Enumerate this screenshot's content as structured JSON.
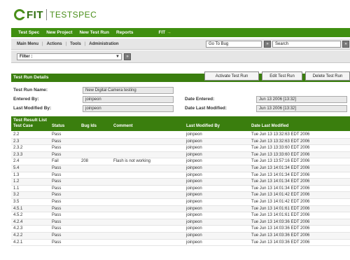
{
  "logo": {
    "fit": "FIT",
    "testspec": "TESTSPEC"
  },
  "main_nav": {
    "items": [
      "Test Spec",
      "New Project",
      "New Test Run",
      "Reports"
    ],
    "user": "FIT",
    "user_accent": "→"
  },
  "sub_nav": {
    "items": [
      "Main Menu",
      "Actions",
      "Tools",
      "Administration"
    ],
    "separator": "|",
    "goto_value": "Go To Bug",
    "search_value": "Search",
    "go_label": "»"
  },
  "filter": {
    "label": "Filter :",
    "chevron": "▼",
    "go_label": "»"
  },
  "test_run_details": {
    "title": "Test Run Details",
    "buttons": [
      "Activate Test Run",
      "Edit Test Run",
      "Delete Test Run"
    ],
    "fields": {
      "name_label": "Test Run Name:",
      "name_value": "New Digital Camera testing",
      "entered_by_label": "Entered By:",
      "entered_by_value": "joinpeon",
      "last_modified_by_label": "Last Modified By:",
      "last_modified_by_value": "joinpeon",
      "date_entered_label": "Date Entered:",
      "date_entered_value": "Jun 13 2006 [13:32]",
      "date_last_modified_label": "Date Last Modified:",
      "date_last_modified_value": "Jun 13 2006 [13:32]"
    }
  },
  "test_result_list": {
    "title": "Test Result List",
    "columns": [
      "Test Case",
      "Status",
      "Bug Ids",
      "Comment",
      "Last Modified By",
      "Date Last Modified"
    ],
    "rows": [
      {
        "case": "2.2",
        "status": "Pass",
        "bug": "",
        "comment": "",
        "mod": "joinpeon",
        "date": "Tue Jun 13 13:32:63 EDT 2006"
      },
      {
        "case": "2.3",
        "status": "Pass",
        "bug": "",
        "comment": "",
        "mod": "joinpeon",
        "date": "Tue Jun 13 13:32:63 EDT 2006"
      },
      {
        "case": "2.3.2",
        "status": "Pass",
        "bug": "",
        "comment": "",
        "mod": "joinpeon",
        "date": "Tue Jun 13 13:33:60 EDT 2006"
      },
      {
        "case": "2.3.3",
        "status": "Pass",
        "bug": "",
        "comment": "",
        "mod": "joinpeon",
        "date": "Tue Jun 13 13:33:60 EDT 2006"
      },
      {
        "case": "2.4",
        "status": "Fail",
        "bug": "208",
        "comment": "Flash is not working",
        "mod": "joinpeon",
        "date": "Tue Jun 13 13:57:16 EDT 2006"
      },
      {
        "case": "5.4",
        "status": "Pass",
        "bug": "",
        "comment": "",
        "mod": "joinpeon",
        "date": "Tue Jun 13 14:01:34 EDT 2006"
      },
      {
        "case": "1.3",
        "status": "Pass",
        "bug": "",
        "comment": "",
        "mod": "joinpeon",
        "date": "Tue Jun 13 14:01:34 EDT 2006"
      },
      {
        "case": "1.2",
        "status": "Pass",
        "bug": "",
        "comment": "",
        "mod": "joinpeon",
        "date": "Tue Jun 13 14:01:34 EDT 2006"
      },
      {
        "case": "1.1",
        "status": "Pass",
        "bug": "",
        "comment": "",
        "mod": "joinpeon",
        "date": "Tue Jun 13 14:01:34 EDT 2006"
      },
      {
        "case": "3.2",
        "status": "Pass",
        "bug": "",
        "comment": "",
        "mod": "joinpeon",
        "date": "Tue Jun 13 14:01:42 EDT 2006"
      },
      {
        "case": "3.5",
        "status": "Pass",
        "bug": "",
        "comment": "",
        "mod": "joinpeon",
        "date": "Tue Jun 13 14:01:42 EDT 2006"
      },
      {
        "case": "4.5.1",
        "status": "Pass",
        "bug": "",
        "comment": "",
        "mod": "joinpeon",
        "date": "Tue Jun 13 14:01:61 EDT 2006"
      },
      {
        "case": "4.5.2",
        "status": "Pass",
        "bug": "",
        "comment": "",
        "mod": "joinpeon",
        "date": "Tue Jun 13 14:01:61 EDT 2006"
      },
      {
        "case": "4.2.4",
        "status": "Pass",
        "bug": "",
        "comment": "",
        "mod": "joinpeon",
        "date": "Tue Jun 13 14:03:36 EDT 2006"
      },
      {
        "case": "4.2.3",
        "status": "Pass",
        "bug": "",
        "comment": "",
        "mod": "joinpeon",
        "date": "Tue Jun 13 14:03:36 EDT 2006"
      },
      {
        "case": "4.2.2",
        "status": "Pass",
        "bug": "",
        "comment": "",
        "mod": "joinpeon",
        "date": "Tue Jun 13 14:03:36 EDT 2006"
      },
      {
        "case": "4.2.1",
        "status": "Pass",
        "bug": "",
        "comment": "",
        "mod": "joinpeon",
        "date": "Tue Jun 13 14:03:36 EDT 2006"
      }
    ]
  }
}
